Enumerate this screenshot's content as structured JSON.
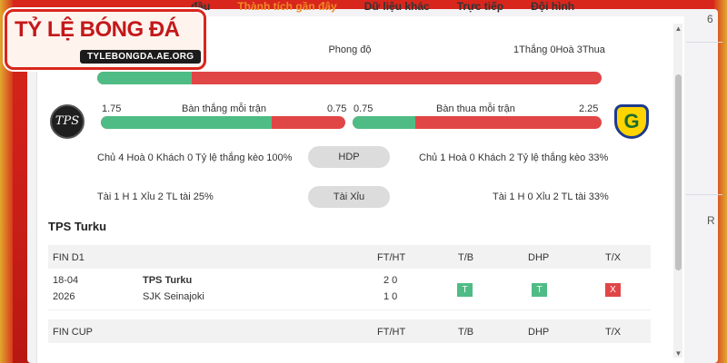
{
  "nav": {
    "items": [
      "...đầu",
      "Thành tích gần đây",
      "Dữ liệu khác",
      "Trực tiếp",
      "Đội hình"
    ],
    "active_index": 1
  },
  "logo": {
    "title": "TỶ LỆ BÓNG ĐÁ",
    "url": "TYLEBONGDA.AE.ORG"
  },
  "form": {
    "label": "Phong độ",
    "summary": "1Thắng 0Hoà 3Thua",
    "win_fraction": 0.25
  },
  "goals": {
    "scored_label": "Bàn thắng mỗi trận",
    "scored_home": "1.75",
    "scored_away": "0.75",
    "conceded_label": "Bàn thua mỗi trận",
    "conceded_home": "0.75",
    "conceded_away": "2.25"
  },
  "hdp": {
    "label": "HDP",
    "home_text": "Chủ 4 Hoà 0 Khách 0 Tỷ lệ thắng kèo 100%",
    "away_text": "Chủ 1 Hoà 0 Khách 2 Tỷ lệ thắng kèo 33%"
  },
  "taixiu": {
    "label": "Tài Xỉu",
    "home_text": "Tài 1 H 1 Xỉu 2 TL tài 25%",
    "away_text": "Tài 1 H 0 Xỉu 2 TL tài 33%"
  },
  "section_title": "TPS Turku",
  "table1": {
    "league": "FIN D1",
    "headers": {
      "fthtl": "FT/HT",
      "tb": "T/B",
      "dhp": "DHP",
      "tx": "T/X"
    },
    "row": {
      "date": "18-04",
      "year": "2026",
      "home": "TPS Turku",
      "away": "SJK Seinajoki",
      "score_home": "2 0",
      "score_away": "1 0",
      "tb": "T",
      "dhp": "T",
      "tx": "X"
    }
  },
  "table2": {
    "league": "FIN CUP",
    "headers": {
      "fthtl": "FT/HT",
      "tb": "T/B",
      "dhp": "DHP",
      "tx": "T/X"
    }
  },
  "side": {
    "numbers": [
      "6",
      "R"
    ]
  },
  "colors": {
    "win": "#4fbc85",
    "loss": "#e14646",
    "accent": "#f08a24",
    "frame": "#d8261d"
  }
}
